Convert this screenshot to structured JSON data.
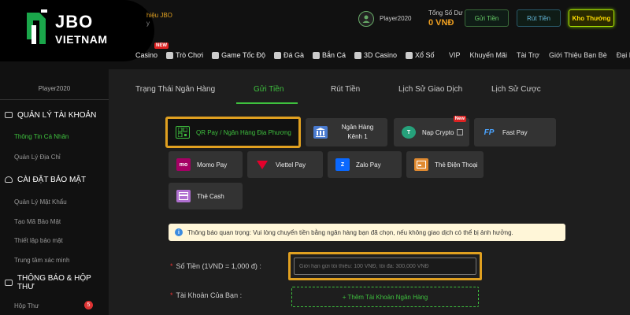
{
  "brand": {
    "name_top": "JBO",
    "name_bottom": "VIETNAM",
    "partner_line": "hiệu JBO",
    "partner_sub": "y"
  },
  "header": {
    "username": "Player2020",
    "balance_label": "Tổng Số Dư",
    "balance_value": "0 VNĐ",
    "deposit_btn": "Gửi Tiền",
    "withdraw_btn": "Rút Tiền",
    "store_btn": "Kho Thưởng"
  },
  "nav": {
    "new_badge": "NEW",
    "items": [
      "Casino",
      "Trò Chơi",
      "Game Tốc Độ",
      "Đá Gà",
      "Bắn Cá",
      "3D Casino",
      "Xổ Số"
    ],
    "right_items": [
      "VIP",
      "Khuyến Mãi",
      "Tài Trợ",
      "Giới Thiệu Bạn Bè",
      "Đại Lý"
    ]
  },
  "sidebar": {
    "username": "Player2020",
    "sections": [
      {
        "title": "QUẢN LÝ TÀI KHOẢN",
        "items": [
          "Thông Tin Cá Nhân",
          "Quản Lý Địa Chỉ"
        ]
      },
      {
        "title": "CÀI ĐẶT BẢO MẬT",
        "items": [
          "Quản Lý Mật Khẩu",
          "Tạo Mã Bảo Mật",
          "Thiết lập bảo mật",
          "Trung tâm xác minh"
        ]
      },
      {
        "title": "THÔNG BÁO & HỘP THƯ",
        "items": [
          "Hộp Thư"
        ]
      }
    ],
    "inbox_count": "5"
  },
  "tabs": [
    "Trạng Thái Ngân Hàng",
    "Gửi Tiền",
    "Rút Tiền",
    "Lịch Sử Giao Dịch",
    "Lịch Sử Cược"
  ],
  "payment_methods": [
    {
      "label": "QR Pay / Ngân Hàng Địa Phương",
      "icon": "qr-icon",
      "selected": true
    },
    {
      "label": "Ngân Hàng Kênh 1",
      "icon": "bank-icon"
    },
    {
      "label": "Nạp Crypto",
      "icon": "tether-icon",
      "badge": "New"
    },
    {
      "label": "Fast Pay",
      "icon": "fastpay-icon"
    },
    {
      "label": "Momo Pay",
      "icon": "momo-icon"
    },
    {
      "label": "Viettel Pay",
      "icon": "viettel-icon"
    },
    {
      "label": "Zalo Pay",
      "icon": "zalo-icon"
    },
    {
      "label": "Thẻ Điện Thoại",
      "icon": "phone-card-icon"
    },
    {
      "label": "Thẻ Cash",
      "icon": "cash-card-icon"
    }
  ],
  "icon_text": {
    "fastpay": "FP",
    "momo": "mo",
    "zalo": "Z",
    "tether": "T",
    "info": "i"
  },
  "notice": "Thông báo quan trọng: Vui lòng chuyển tiền bằng ngân hàng bạn đã chọn, nếu không giao dịch có thể bị ảnh hưởng.",
  "form": {
    "amount_label": "Số Tiền (1VND = 1,000 đ)  :",
    "amount_placeholder": "Giới hạn gửi tối thiểu: 100 VNĐ, tối đa: 300,000 VNĐ",
    "account_label": "Tài Khoản Của Bạn  :",
    "add_account_btn": "+ Thêm Tài Khoản Ngân Hàng",
    "required_mark": "*"
  },
  "colors": {
    "accent_green": "#3ec03e",
    "highlight_gold": "#e0a020",
    "background": "#1e1e1e"
  }
}
